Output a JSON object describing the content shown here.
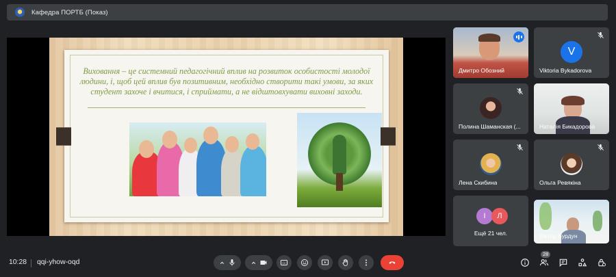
{
  "meeting": {
    "presenting_title": "Кафедра ПОРТБ (Показ)",
    "time": "10:28",
    "code": "qqi-yhow-oqd"
  },
  "slide": {
    "quote": "Виховання – це системний педагогічний вплив на розвиток особистості молодої людини, і, щоб цей вплив був позитивним, необхідно створити такі умови, за яких студент захоче і вчитися, і сприймати, а не відштовхувати виховні заходи."
  },
  "participants": [
    {
      "name": "Дмитро Обозний",
      "avatar": "",
      "speaking": true
    },
    {
      "name": "Viktoria Bykadorova",
      "avatar": "V",
      "muted": true
    },
    {
      "name": "Полина Шаманская (...",
      "avatar": "",
      "muted": true
    },
    {
      "name": "Наталія Бикадорова",
      "avatar": "",
      "muted": true
    },
    {
      "name": "Лена Скибина",
      "avatar": "",
      "muted": true
    },
    {
      "name": "Ольга Ревякіна",
      "avatar": "",
      "muted": true
    },
    {
      "name": "Ещё 21 чел.",
      "avatars": [
        "І",
        "Л"
      ]
    },
    {
      "name": "Віктор Бурдун",
      "avatar": ""
    }
  ],
  "toolbar": {
    "participant_count": "28"
  },
  "colors": {
    "background": "#202124",
    "tile": "#3c4043",
    "end_call": "#ea4335",
    "accent": "#1a73e8",
    "quote_text": "#7f9a47"
  },
  "icons": [
    "mic-icon",
    "camera-icon",
    "captions-icon",
    "emoji-icon",
    "present-icon",
    "hand-icon",
    "more-icon",
    "end-call-icon",
    "info-icon",
    "people-icon",
    "chat-icon",
    "activities-icon",
    "host-controls-icon"
  ]
}
